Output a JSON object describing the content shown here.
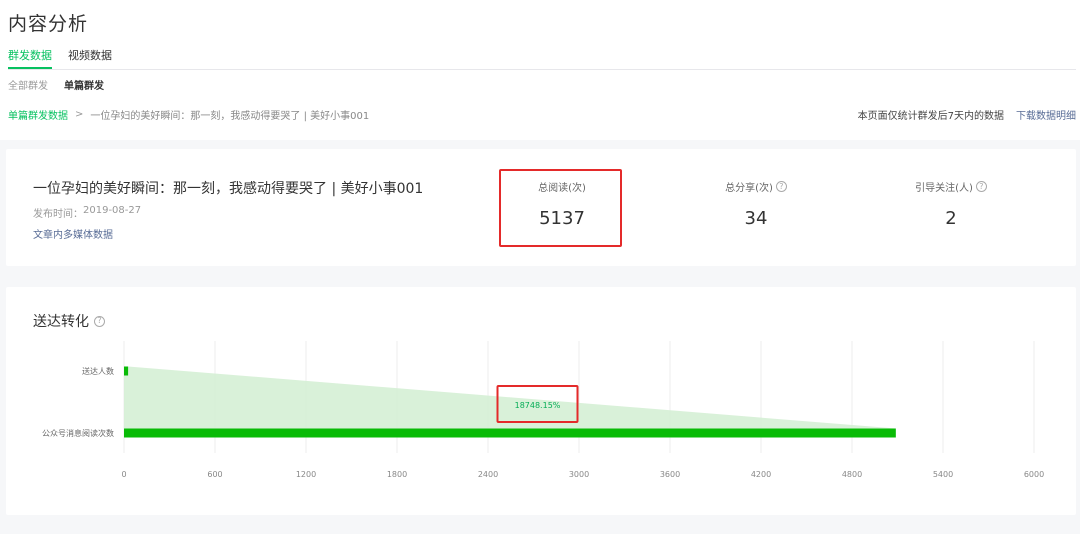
{
  "page": {
    "title": "内容分析"
  },
  "tabs": [
    {
      "label": "群发数据",
      "active": true
    },
    {
      "label": "视频数据",
      "active": false
    }
  ],
  "subtabs": [
    {
      "label": "全部群发",
      "active": false
    },
    {
      "label": "单篇群发",
      "active": true
    }
  ],
  "breadcrumb": {
    "parent": "单篇群发数据",
    "separator": ">",
    "current": "一位孕妇的美好瞬间：那一刻，我感动得要哭了 | 美好小事001"
  },
  "notice": {
    "text": "本页面仅统计群发后7天内的数据",
    "download": "下载数据明细"
  },
  "article": {
    "title": "一位孕妇的美好瞬间：那一刻，我感动得要哭了 | 美好小事001",
    "publish_label": "发布时间：",
    "publish_date": "2019-08-27",
    "media_link": "文章内多媒体数据"
  },
  "stats": [
    {
      "label": "总阅读(次)",
      "value": "5137",
      "help": false,
      "highlighted": true
    },
    {
      "label": "总分享(次)",
      "value": "34",
      "help": true
    },
    {
      "label": "引导关注(人)",
      "value": "2",
      "help": true
    }
  ],
  "conversion": {
    "title": "送达转化"
  },
  "colors": {
    "accent": "#07c160",
    "link": "#576b95",
    "highlight": "#e42a2a",
    "bar": "#09bb07",
    "funnel": "#d5efd5"
  },
  "chart_data": {
    "type": "bar",
    "orientation": "horizontal",
    "categories": [
      "送达人数",
      "公众号消息阅读次数"
    ],
    "values": [
      27,
      5089
    ],
    "conversion_rate": "18748.15%",
    "xlim": [
      0,
      6000
    ],
    "xticks": [
      "0",
      "600",
      "1200",
      "1800",
      "2400",
      "3000",
      "3600",
      "4200",
      "4800",
      "5400",
      "6000"
    ],
    "grid": true,
    "highlight_label": true
  }
}
